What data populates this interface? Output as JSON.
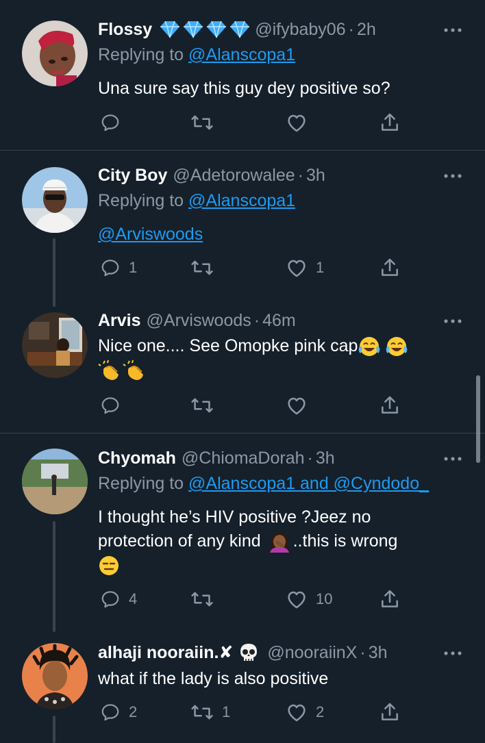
{
  "colors": {
    "background": "#15202b",
    "text": "#ffffff",
    "secondary": "#8b98a5",
    "link": "#1d9bf0",
    "divider": "#38444d"
  },
  "tweets": [
    {
      "name": "Flossy",
      "badges": [
        "blue-diamond",
        "blue-diamond",
        "blue-diamond",
        "blue-diamond"
      ],
      "handle": "@ifybaby06",
      "time": "2h",
      "replying_prefix": "Replying to",
      "replying_to": "@Alanscopa1",
      "text": "Una sure say this guy dey positive so?",
      "replies": "",
      "retweets": "",
      "likes": ""
    },
    {
      "name": "City Boy",
      "handle": "@Adetorowalee",
      "time": "3h",
      "replying_prefix": "Replying to",
      "replying_to": "@Alanscopa1",
      "text_link": "@Arviswoods",
      "replies": "1",
      "retweets": "",
      "likes": "1"
    },
    {
      "name": "Arvis",
      "handle": "@Arviswoods",
      "time": "46m",
      "text": "Nice one.... See Omopke pink cap",
      "emojis": [
        "face-with-tears-of-joy",
        "face-with-tears-of-joy",
        "clapping-hands",
        "clapping-hands"
      ],
      "replies": "",
      "retweets": "",
      "likes": ""
    },
    {
      "name": "Chyomah",
      "handle": "@ChiomaDorah",
      "time": "3h",
      "replying_prefix": "Replying to",
      "replying_to": "@Alanscopa1 and @Cyndodo_",
      "text_line1": "I thought he’s HIV positive ?Jeez no",
      "text_line2a": "protection of any kind",
      "text_line2b": "..this is wrong",
      "emojis": [
        "woman-facepalming",
        "expressionless-face"
      ],
      "replies": "4",
      "retweets": "",
      "likes": "10"
    },
    {
      "name": "alhaji nooraiin.✘",
      "name_emoji": "skull",
      "handle": "@nooraiinX",
      "time": "3h",
      "text": "what if the lady is also positive",
      "replies": "2",
      "retweets": "1",
      "likes": "2"
    }
  ]
}
